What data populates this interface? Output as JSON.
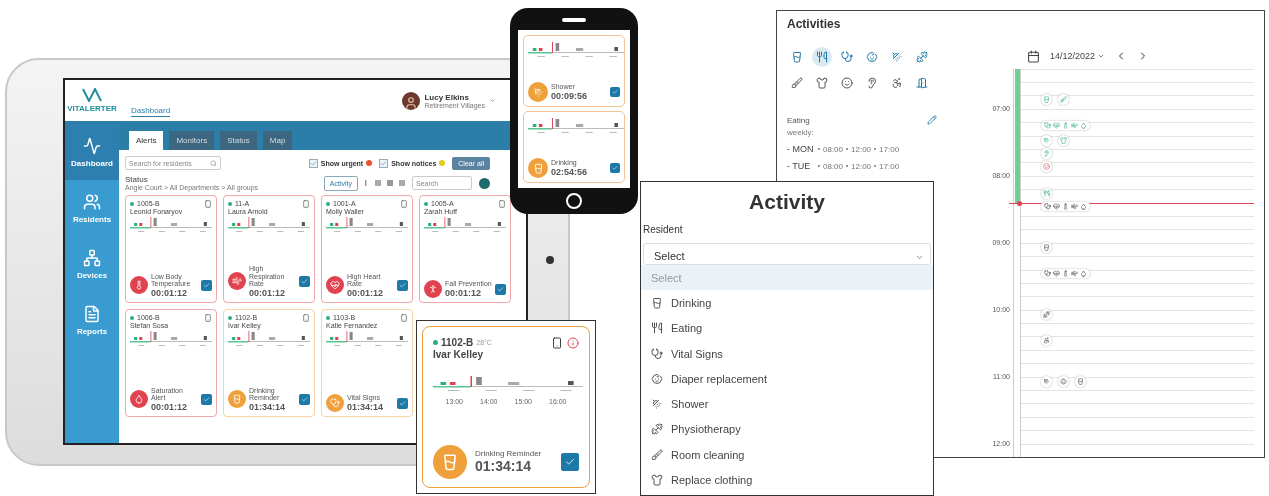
{
  "tablet": {
    "logo": "VITALERTER",
    "nav_tab": "Dashboard",
    "user": {
      "name": "Lucy Elkins",
      "org": "Retirement Villages"
    },
    "sidebar": [
      {
        "label": "Dashboard",
        "kind": "dashboard",
        "selected": true
      },
      {
        "label": "Residents",
        "kind": "residents",
        "selected": false
      },
      {
        "label": "Devices",
        "kind": "devices",
        "selected": false
      },
      {
        "label": "Reports",
        "kind": "reports",
        "selected": false
      }
    ],
    "tabs": [
      {
        "label": "Alerts",
        "selected": true
      },
      {
        "label": "Monitors",
        "selected": false
      },
      {
        "label": "Status",
        "selected": false
      },
      {
        "label": "Map",
        "selected": false
      }
    ],
    "search": {
      "placeholder": "Search for residents"
    },
    "filters": [
      {
        "label": "Show urgent",
        "checked": true,
        "color": "#e8502f"
      },
      {
        "label": "Show notices",
        "checked": true,
        "color": "#e6c81e"
      }
    ],
    "clear_button": "Clear all",
    "status_title": "Status",
    "breadcrumb": "Angle Court > All Departments > All groups",
    "activity_button": "Activity",
    "status_search": {
      "placeholder": "Search"
    },
    "cards": [
      {
        "room": "1005-B",
        "name": "Leonid Fonaryov",
        "alert": "Low Body Temperature",
        "timer": "00:01:12",
        "kind": "temperature",
        "color": "#e0434f"
      },
      {
        "room": "11-A",
        "name": "Laura Arnold",
        "alert": "High Respiration Rate",
        "timer": "00:01:12",
        "kind": "respiration",
        "color": "#e0434f"
      },
      {
        "room": "1001-A",
        "name": "Molly Waller",
        "alert": "High Heart Rate",
        "timer": "00:01:12",
        "kind": "heart",
        "color": "#e0434f"
      },
      {
        "room": "1005-A",
        "name": "Zarah Huff",
        "alert": "Fall Prevention",
        "timer": "00:01:12",
        "kind": "fall",
        "color": "#e0434f"
      },
      {
        "room": "1006-B",
        "name": "Stefan Sosa",
        "alert": "Saturation Alert",
        "timer": "00:01:12",
        "kind": "saturation",
        "color": "#e0434f"
      },
      {
        "room": "1102-B",
        "name": "Ivar Kelley",
        "alert": "Drinking Reminder",
        "timer": "01:34:14",
        "kind": "drink",
        "color": "#f0a03a"
      },
      {
        "room": "1103-B",
        "name": "Katie Fernandez",
        "alert": "Vital Signs",
        "timer": "01:34:14",
        "kind": "vital",
        "color": "#f0a03a"
      }
    ]
  },
  "phone": {
    "cards": [
      {
        "activity": "Shower",
        "timer": "00:09:56",
        "kind": "shower"
      },
      {
        "activity": "Drinking",
        "timer": "02:54:56",
        "kind": "drink"
      }
    ]
  },
  "activities": {
    "title": "Activities",
    "types": [
      {
        "kind": "drink",
        "selected": false
      },
      {
        "kind": "eating",
        "selected": true
      },
      {
        "kind": "vital",
        "selected": false
      },
      {
        "kind": "diaper",
        "selected": false
      },
      {
        "kind": "shower",
        "selected": false
      },
      {
        "kind": "physio",
        "selected": false
      },
      {
        "kind": "cleaning",
        "selected": false
      },
      {
        "kind": "clothing",
        "selected": false
      },
      {
        "kind": "teeth",
        "selected": false
      },
      {
        "kind": "hearing",
        "selected": false
      },
      {
        "kind": "walk",
        "selected": false
      },
      {
        "kind": "door",
        "selected": false
      }
    ],
    "detail": {
      "name": "Eating",
      "frequency": "weekly:",
      "schedule": [
        {
          "day": "- MON",
          "times": [
            "08:00",
            "12:00",
            "17:00"
          ]
        },
        {
          "day": "- TUE",
          "times": [
            "08:00",
            "12:00",
            "17:00"
          ]
        }
      ]
    },
    "date": "14/12/2022",
    "slots": [
      {
        "kind": "empty"
      },
      {
        "kind": "empty"
      },
      {
        "kind": "event",
        "markers": [
          {
            "kind": "drink"
          },
          {
            "kind": "cleaning"
          }
        ]
      },
      {
        "kind": "empty",
        "hour": "07:00"
      },
      {
        "kind": "group",
        "markers": [
          {
            "kind": "vital"
          },
          {
            "kind": "heart"
          },
          {
            "kind": "temperature"
          },
          {
            "kind": "respiration"
          },
          {
            "kind": "saturation"
          }
        ]
      },
      {
        "kind": "event",
        "markers": [
          {
            "kind": "shower"
          },
          {
            "kind": "clothing"
          }
        ]
      },
      {
        "kind": "event",
        "markers": [
          {
            "kind": "hearing"
          }
        ]
      },
      {
        "kind": "event",
        "markers": [
          {
            "kind": "teeth"
          }
        ],
        "alert": true
      },
      {
        "kind": "empty",
        "hour": "08:00"
      },
      {
        "kind": "event",
        "markers": [
          {
            "kind": "eating"
          }
        ]
      },
      {
        "kind": "group",
        "markers": [
          {
            "kind": "vital"
          },
          {
            "kind": "heart"
          },
          {
            "kind": "temperature"
          },
          {
            "kind": "respiration"
          },
          {
            "kind": "saturation"
          }
        ],
        "now": true
      },
      {
        "kind": "empty"
      },
      {
        "kind": "empty"
      },
      {
        "kind": "event",
        "markers": [
          {
            "kind": "drink"
          }
        ],
        "hour": "09:00"
      },
      {
        "kind": "empty"
      },
      {
        "kind": "group",
        "markers": [
          {
            "kind": "vital"
          },
          {
            "kind": "heart"
          },
          {
            "kind": "temperature"
          },
          {
            "kind": "respiration"
          },
          {
            "kind": "saturation"
          }
        ]
      },
      {
        "kind": "empty"
      },
      {
        "kind": "empty"
      },
      {
        "kind": "event",
        "markers": [
          {
            "kind": "physio"
          }
        ],
        "hour": "10:00"
      },
      {
        "kind": "empty"
      },
      {
        "kind": "event",
        "markers": [
          {
            "kind": "walk"
          }
        ]
      },
      {
        "kind": "empty"
      },
      {
        "kind": "empty"
      },
      {
        "kind": "event",
        "markers": [
          {
            "kind": "shower"
          },
          {
            "kind": "diaper"
          },
          {
            "kind": "drink"
          }
        ],
        "hour": "11:00"
      },
      {
        "kind": "empty"
      },
      {
        "kind": "empty"
      },
      {
        "kind": "empty"
      },
      {
        "kind": "empty"
      },
      {
        "kind": "empty",
        "hour": "12:00"
      }
    ]
  },
  "activity_dialog": {
    "title": "Activity",
    "label": "Resident",
    "placeholder": "Select",
    "options": [
      {
        "label": "Select",
        "kind": "none",
        "selected": true
      },
      {
        "label": "Drinking",
        "kind": "drink",
        "selected": false
      },
      {
        "label": "Eating",
        "kind": "eating",
        "selected": false
      },
      {
        "label": "Vital Signs",
        "kind": "vital",
        "selected": false
      },
      {
        "label": "Diaper replacement",
        "kind": "diaper",
        "selected": false
      },
      {
        "label": "Shower",
        "kind": "shower",
        "selected": false
      },
      {
        "label": "Physiotherapy",
        "kind": "physio",
        "selected": false
      },
      {
        "label": "Room cleaning",
        "kind": "cleaning",
        "selected": false
      },
      {
        "label": "Replace clothing",
        "kind": "clothing",
        "selected": false
      }
    ]
  },
  "alert_card": {
    "room": "1102-B",
    "temp": "28°C",
    "name": "Ivar Kelley",
    "ticks": [
      "13:00",
      "14:00",
      "15:00",
      "16:00"
    ],
    "alert": "Drinking Reminder",
    "timer": "01:34:14",
    "kind": "drink",
    "color": "#f0a03a"
  }
}
